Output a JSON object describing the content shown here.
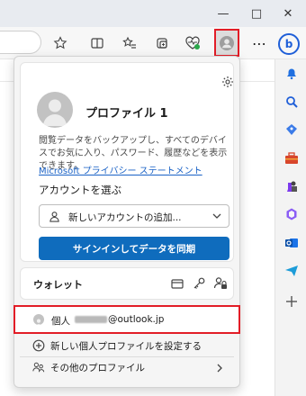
{
  "window": {
    "minimize_glyph": "—",
    "maximize_glyph": "□",
    "close_glyph": "✕"
  },
  "toolbar": {
    "icons": [
      "star-icon",
      "split-screen-icon",
      "favorites-icon",
      "collections-icon",
      "browser-essentials-icon",
      "profile-icon",
      "more-icon"
    ],
    "more_glyph": "⋯"
  },
  "sidebar": {
    "bing_label": "b",
    "icons": [
      "notifications-icon",
      "search-icon",
      "shopping-icon",
      "tools-icon",
      "games-icon",
      "microsoft365-icon",
      "outlook-icon",
      "drop-icon",
      "add-icon"
    ]
  },
  "flyout": {
    "profile_name": "プロファイル 1",
    "sync_description": "閲覧データをバックアップし、すべてのデバイスでお気に入り、パスワード、履歴などを表示できます。",
    "privacy_link": "Microsoft プライバシー ステートメント",
    "choose_account_label": "アカウントを選ぶ",
    "account_select_value": "新しいアカウントの追加...",
    "sync_button": "サインインしてデータを同期",
    "wallet_label": "ウォレット",
    "current_profile_label": "個人",
    "current_profile_email": "@outlook.jp",
    "add_profile_label": "新しい個人プロファイルを設定する",
    "other_profiles_label": "その他のプロファイル"
  },
  "colors": {
    "accent": "#0f6cbd",
    "highlight": "#e21d27",
    "link": "#1a62c6"
  }
}
